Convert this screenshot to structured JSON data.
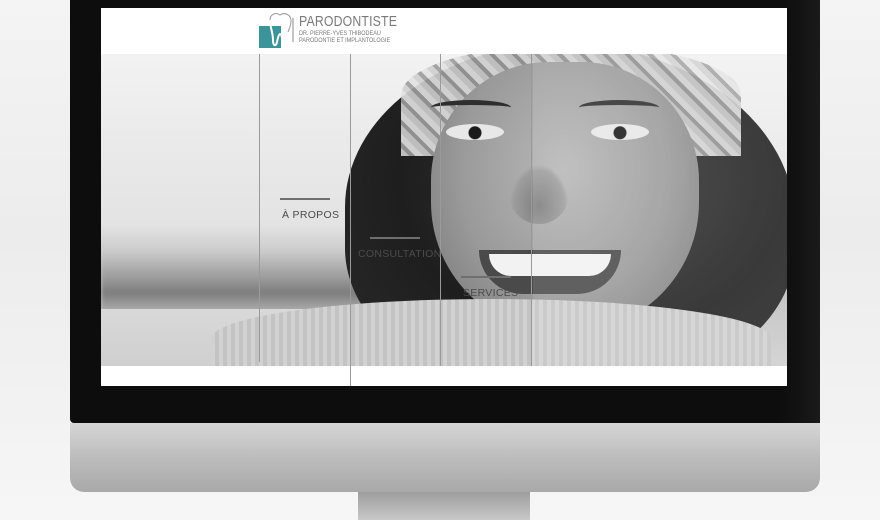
{
  "logo": {
    "title": "PARODONTISTE",
    "line1": "DR. PIERRE-YVES THIBODEAU",
    "line2": "PARODONTIE ET IMPLANTOLOGIE",
    "accent_color": "#3a9499"
  },
  "nav": {
    "items": [
      {
        "label": "À PROPOS"
      },
      {
        "label": "CONSULTATION"
      },
      {
        "label": "SERVICES"
      }
    ]
  },
  "hero": {
    "image": "smiling-woman-portrait"
  },
  "colors": {
    "background": "#efefef",
    "text": "#4b4b4b",
    "accent": "#3a9499"
  }
}
